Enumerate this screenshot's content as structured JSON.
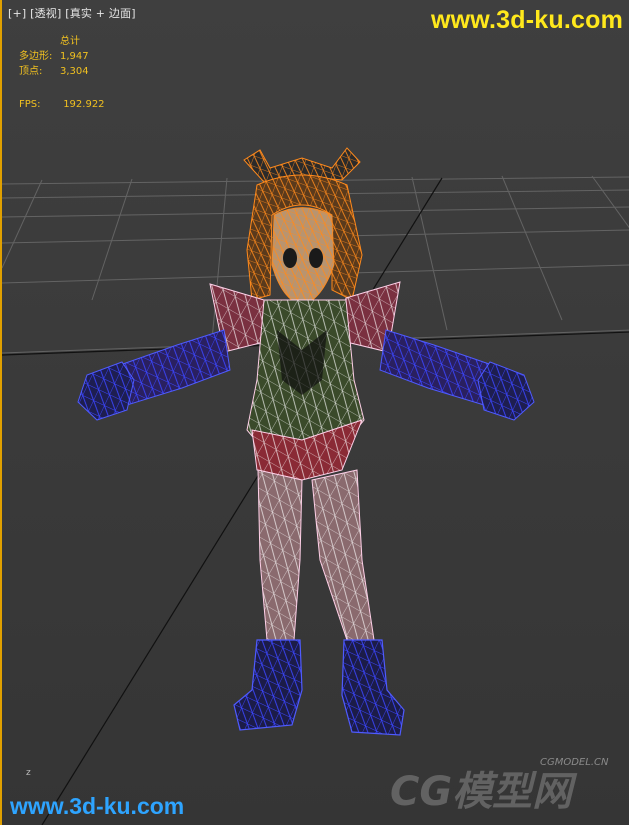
{
  "viewport": {
    "label_plus": "[+]",
    "label_view": "[透视]",
    "label_shading": "[真实 + 边面]"
  },
  "stats": {
    "title": "总计",
    "polys_label": "多边形:",
    "polys_value": "1,947",
    "verts_label": "顶点:",
    "verts_value": "3,304",
    "fps_label": "FPS:",
    "fps_value": "192.922"
  },
  "watermarks": {
    "top": "www.3d-ku.com",
    "bottom": "www.3d-ku.com",
    "cg_url": "CGMODEL.CN",
    "cg_text": "CG模型网"
  },
  "axis_label": "z",
  "colors": {
    "stats_text": "#f0c020",
    "top_watermark": "#ffe81c",
    "bottom_watermark": "#2ea4ff",
    "viewport_border": "#e0a000"
  }
}
